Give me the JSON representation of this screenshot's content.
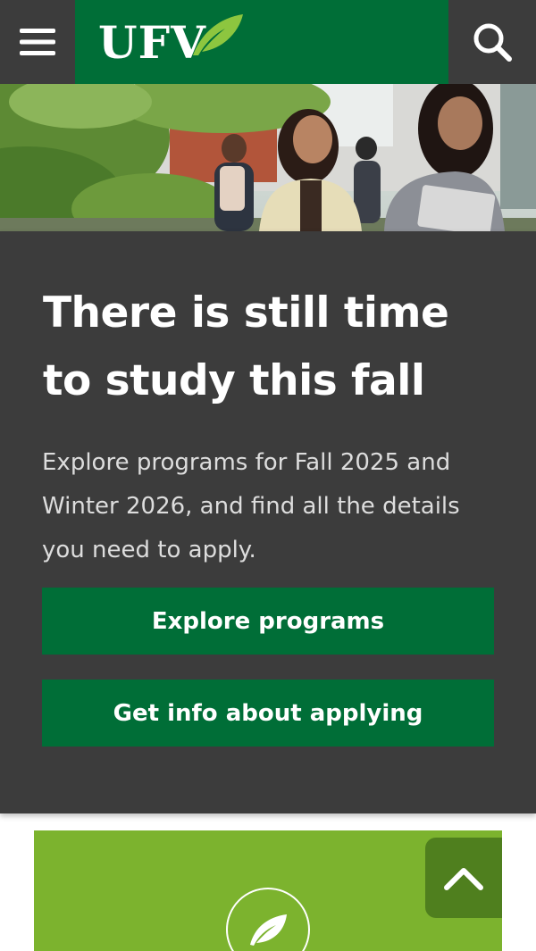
{
  "header": {
    "logo_text": "UFV",
    "menu_icon": "hamburger-menu-icon",
    "search_icon": "search-icon",
    "colors": {
      "bar": "#3c3c3c",
      "logo_bg": "#006e37"
    }
  },
  "hero": {
    "image": "students-walking-campus-photo"
  },
  "card": {
    "title": "There is still time to study this fall",
    "body": "Explore programs for Fall 2025 and Winter 2026, and find all the details you need to apply.",
    "buttons": [
      {
        "label": "Explore programs"
      },
      {
        "label": "Get info about applying"
      }
    ],
    "colors": {
      "background": "#3c3c3c",
      "button": "#006e37"
    }
  },
  "promo": {
    "icon": "leaf-icon",
    "color": "#7cb32e"
  },
  "scroll_top": {
    "icon": "chevron-up-icon",
    "color": "#4f7f1e"
  }
}
